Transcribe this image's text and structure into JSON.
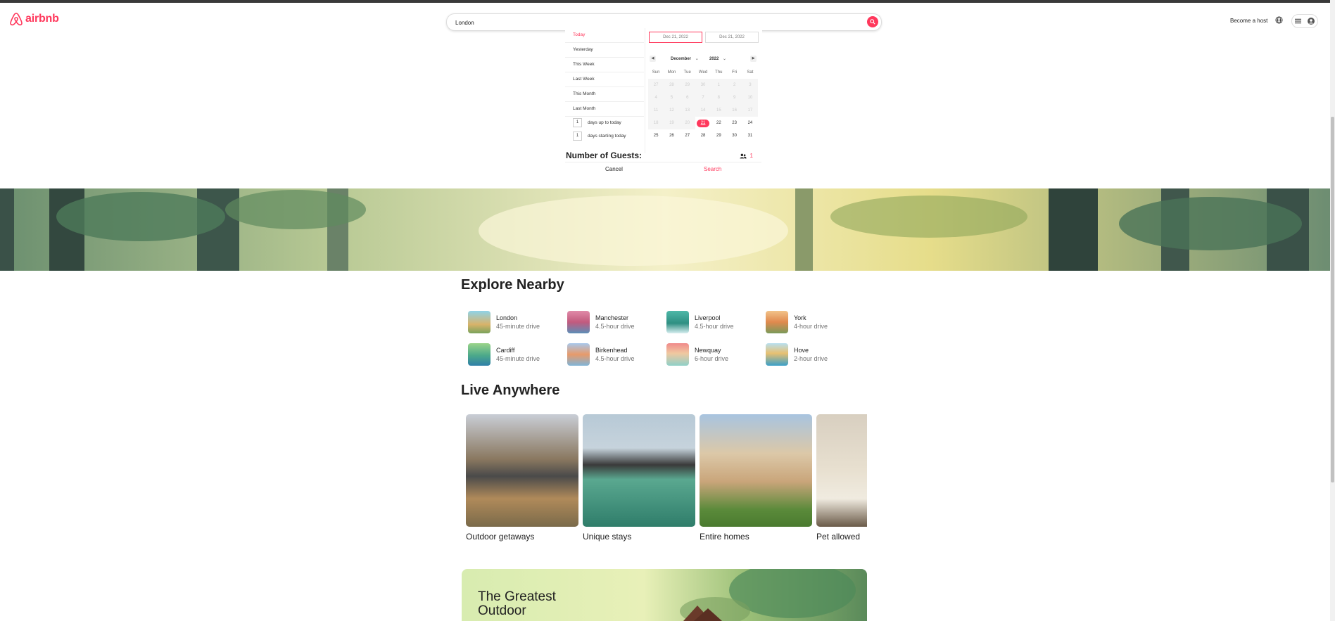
{
  "brand": {
    "name": "airbnb",
    "color": "#ff385c"
  },
  "header": {
    "search_value": "London",
    "become_host": "Become a host",
    "icons": [
      "globe-icon",
      "menu-icon",
      "user-icon",
      "search-icon"
    ]
  },
  "date_picker": {
    "ranges": [
      "Today",
      "Yesterday",
      "This Week",
      "Last Week",
      "This Month",
      "Last Month"
    ],
    "active_range": "Today",
    "days_up": {
      "value": "1",
      "label": "days up to today"
    },
    "days_start": {
      "value": "1",
      "label": "days starting today"
    },
    "start_date": "Dec 21, 2022",
    "end_date": "Dec 21, 2022",
    "month": "December",
    "year": "2022",
    "weekdays": [
      "Sun",
      "Mon",
      "Tue",
      "Wed",
      "Thu",
      "Fri",
      "Sat"
    ],
    "days": [
      "27",
      "28",
      "29",
      "30",
      "1",
      "2",
      "3",
      "4",
      "5",
      "6",
      "7",
      "8",
      "9",
      "10",
      "11",
      "12",
      "13",
      "14",
      "15",
      "16",
      "17",
      "18",
      "19",
      "20",
      "21",
      "22",
      "23",
      "24",
      "25",
      "26",
      "27",
      "28",
      "29",
      "30",
      "31"
    ],
    "selected_day": "21"
  },
  "guests": {
    "label": "Number of Guests:",
    "count": "1"
  },
  "actions": {
    "cancel": "Cancel",
    "search": "Search"
  },
  "explore": {
    "title": "Explore Nearby",
    "places": [
      {
        "name": "London",
        "dist": "45-minute drive"
      },
      {
        "name": "Manchester",
        "dist": "4.5-hour drive"
      },
      {
        "name": "Liverpool",
        "dist": "4.5-hour drive"
      },
      {
        "name": "York",
        "dist": "4-hour drive"
      },
      {
        "name": "Cardiff",
        "dist": "45-minute drive"
      },
      {
        "name": "Birkenhead",
        "dist": "4.5-hour drive"
      },
      {
        "name": "Newquay",
        "dist": "6-hour drive"
      },
      {
        "name": "Hove",
        "dist": "2-hour drive"
      }
    ]
  },
  "live": {
    "title": "Live Anywhere",
    "cards": [
      "Outdoor getaways",
      "Unique stays",
      "Entire homes",
      "Pet allowed"
    ]
  },
  "banner": {
    "title": "The Greatest Outdoor"
  }
}
